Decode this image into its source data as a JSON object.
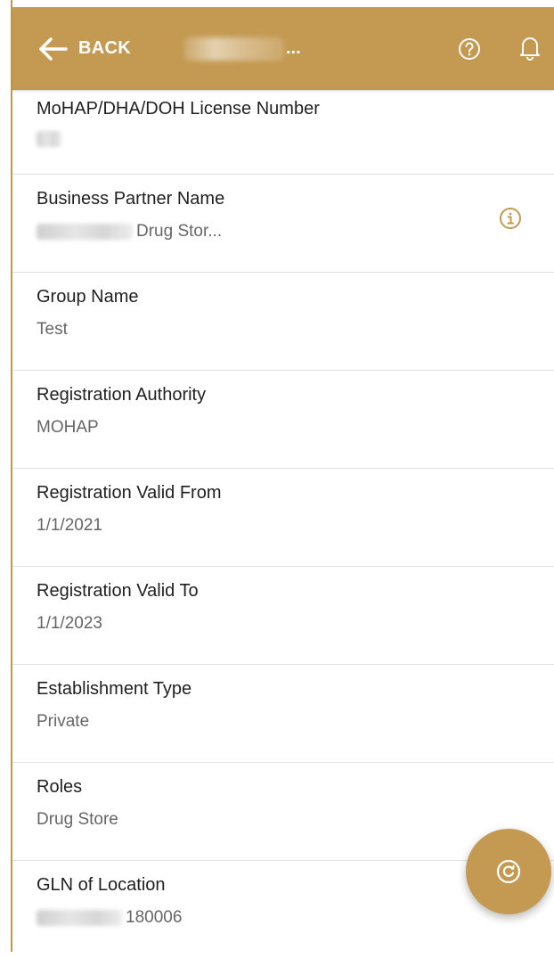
{
  "colors": {
    "accent": "#c49a52",
    "label": "#1f1f1f",
    "value": "#666666",
    "divider": "#e2e2e2"
  },
  "header": {
    "back_label": "BACK",
    "title_ellipsis": "...",
    "icons": [
      "arrow-left-icon",
      "help-icon",
      "bell-icon"
    ]
  },
  "fields": {
    "license": {
      "label": "MoHAP/DHA/DOH License Number",
      "value": ""
    },
    "partner": {
      "label": "Business Partner Name",
      "value": "Drug Stor..."
    },
    "group": {
      "label": "Group Name",
      "value": "Test"
    },
    "authority": {
      "label": "Registration Authority",
      "value": "MOHAP"
    },
    "valid_from": {
      "label": "Registration Valid From",
      "value": "1/1/2021"
    },
    "valid_to": {
      "label": "Registration Valid To",
      "value": "1/1/2023"
    },
    "est_type": {
      "label": "Establishment Type",
      "value": "Private"
    },
    "roles": {
      "label": "Roles",
      "value": "Drug Store"
    },
    "gln": {
      "label": "GLN of Location",
      "value": "180006"
    }
  },
  "fab": {
    "icon": "refresh-icon"
  }
}
